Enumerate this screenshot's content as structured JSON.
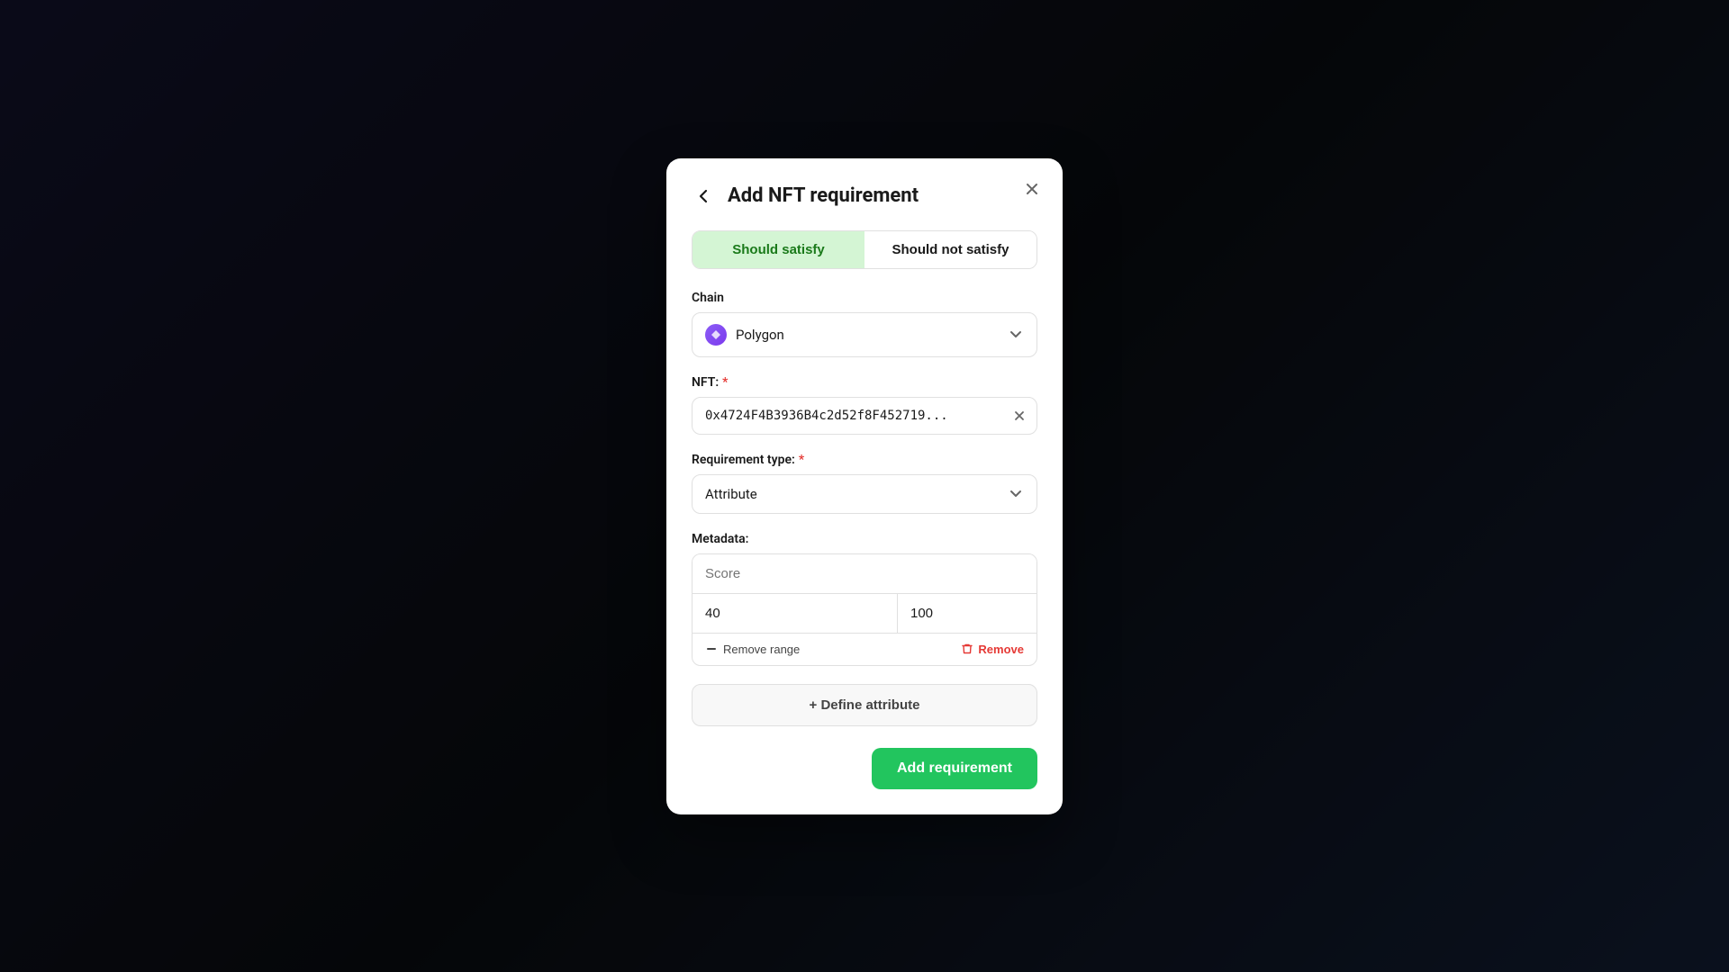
{
  "background": {
    "color": "#0d1117"
  },
  "modal": {
    "title": "Add NFT requirement",
    "close_label": "×",
    "back_label": "←"
  },
  "tabs": {
    "satisfy_label": "Should satisfy",
    "not_satisfy_label": "Should not satisfy",
    "active": "satisfy"
  },
  "chain_field": {
    "label": "Chain",
    "value": "Polygon"
  },
  "nft_field": {
    "label": "NFT:",
    "required": "*",
    "value": "0x4724F4B3936B4c2d52f8F452719..."
  },
  "requirement_type_field": {
    "label": "Requirement type:",
    "required": "*",
    "value": "Attribute"
  },
  "metadata_field": {
    "label": "Metadata:",
    "name_placeholder": "Score",
    "range_min": "40",
    "range_max": "100",
    "remove_range_label": "Remove range",
    "remove_label": "Remove"
  },
  "define_attr_button": {
    "label": "+ Define attribute"
  },
  "add_button": {
    "label": "Add requirement"
  }
}
